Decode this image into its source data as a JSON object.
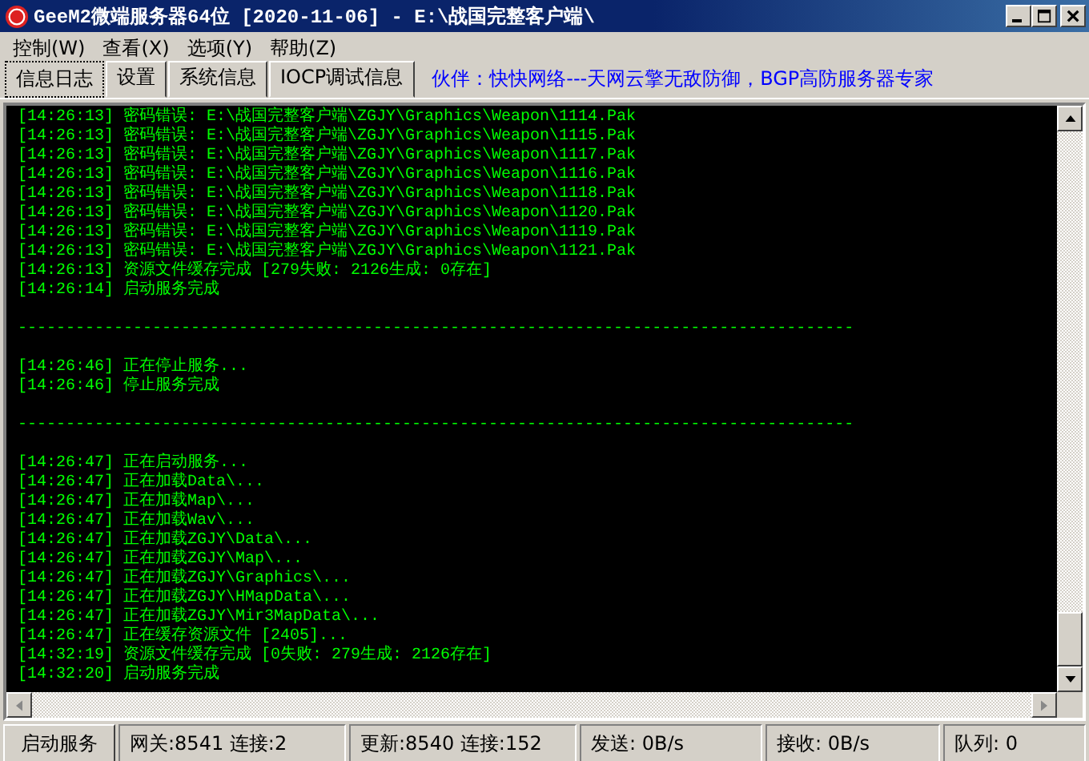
{
  "window": {
    "title": "GeeM2微端服务器64位 [2020-11-06] - E:\\战国完整客户端\\"
  },
  "menu": [
    "控制(W)",
    "查看(X)",
    "选项(Y)",
    "帮助(Z)"
  ],
  "tabs": [
    {
      "label": "信息日志",
      "selected": true
    },
    {
      "label": "设置",
      "selected": false
    },
    {
      "label": "系统信息",
      "selected": false
    },
    {
      "label": "IOCP调试信息",
      "selected": false
    }
  ],
  "partner_text": "伙伴：快快网络---天网云擎无敌防御，BGP高防服务器专家",
  "log": [
    {
      "kind": "line",
      "time": "[14:26:13]",
      "message": "密码错误: E:\\战国完整客户端\\ZGJY\\Graphics\\Weapon\\1114.Pak"
    },
    {
      "kind": "line",
      "time": "[14:26:13]",
      "message": "密码错误: E:\\战国完整客户端\\ZGJY\\Graphics\\Weapon\\1115.Pak"
    },
    {
      "kind": "line",
      "time": "[14:26:13]",
      "message": "密码错误: E:\\战国完整客户端\\ZGJY\\Graphics\\Weapon\\1117.Pak"
    },
    {
      "kind": "line",
      "time": "[14:26:13]",
      "message": "密码错误: E:\\战国完整客户端\\ZGJY\\Graphics\\Weapon\\1116.Pak"
    },
    {
      "kind": "line",
      "time": "[14:26:13]",
      "message": "密码错误: E:\\战国完整客户端\\ZGJY\\Graphics\\Weapon\\1118.Pak"
    },
    {
      "kind": "line",
      "time": "[14:26:13]",
      "message": "密码错误: E:\\战国完整客户端\\ZGJY\\Graphics\\Weapon\\1120.Pak"
    },
    {
      "kind": "line",
      "time": "[14:26:13]",
      "message": "密码错误: E:\\战国完整客户端\\ZGJY\\Graphics\\Weapon\\1119.Pak"
    },
    {
      "kind": "line",
      "time": "[14:26:13]",
      "message": "密码错误: E:\\战国完整客户端\\ZGJY\\Graphics\\Weapon\\1121.Pak"
    },
    {
      "kind": "line",
      "time": "[14:26:13]",
      "message": "资源文件缓存完成 [279失败: 2126生成: 0存在]"
    },
    {
      "kind": "line",
      "time": "[14:26:14]",
      "message": "启动服务完成"
    },
    {
      "kind": "blank"
    },
    {
      "kind": "separator",
      "text": "---------------------------------------------------------------------------------------"
    },
    {
      "kind": "blank"
    },
    {
      "kind": "line",
      "time": "[14:26:46]",
      "message": "正在停止服务..."
    },
    {
      "kind": "line",
      "time": "[14:26:46]",
      "message": "停止服务完成"
    },
    {
      "kind": "blank"
    },
    {
      "kind": "separator",
      "text": "---------------------------------------------------------------------------------------"
    },
    {
      "kind": "blank"
    },
    {
      "kind": "line",
      "time": "[14:26:47]",
      "message": "正在启动服务..."
    },
    {
      "kind": "line",
      "time": "[14:26:47]",
      "message": "正在加载Data\\..."
    },
    {
      "kind": "line",
      "time": "[14:26:47]",
      "message": "正在加载Map\\..."
    },
    {
      "kind": "line",
      "time": "[14:26:47]",
      "message": "正在加载Wav\\..."
    },
    {
      "kind": "line",
      "time": "[14:26:47]",
      "message": "正在加载ZGJY\\Data\\..."
    },
    {
      "kind": "line",
      "time": "[14:26:47]",
      "message": "正在加载ZGJY\\Map\\..."
    },
    {
      "kind": "line",
      "time": "[14:26:47]",
      "message": "正在加载ZGJY\\Graphics\\..."
    },
    {
      "kind": "line",
      "time": "[14:26:47]",
      "message": "正在加载ZGJY\\HMapData\\..."
    },
    {
      "kind": "line",
      "time": "[14:26:47]",
      "message": "正在加载ZGJY\\Mir3MapData\\..."
    },
    {
      "kind": "line",
      "time": "[14:26:47]",
      "message": "正在缓存资源文件 [2405]..."
    },
    {
      "kind": "line",
      "time": "[14:32:19]",
      "message": "资源文件缓存完成 [0失败: 279生成: 2126存在]"
    },
    {
      "kind": "line",
      "time": "[14:32:20]",
      "message": "启动服务完成"
    }
  ],
  "status_bar": [
    {
      "kind": "button",
      "text": "启动服务"
    },
    {
      "kind": "panel",
      "text": "网关:8541  连接:2"
    },
    {
      "kind": "panel",
      "text": "更新:8540  连接:152"
    },
    {
      "kind": "panel",
      "text": "发送: 0B/s"
    },
    {
      "kind": "panel",
      "text": "接收: 0B/s"
    },
    {
      "kind": "panel",
      "text": "队列: 0"
    }
  ]
}
